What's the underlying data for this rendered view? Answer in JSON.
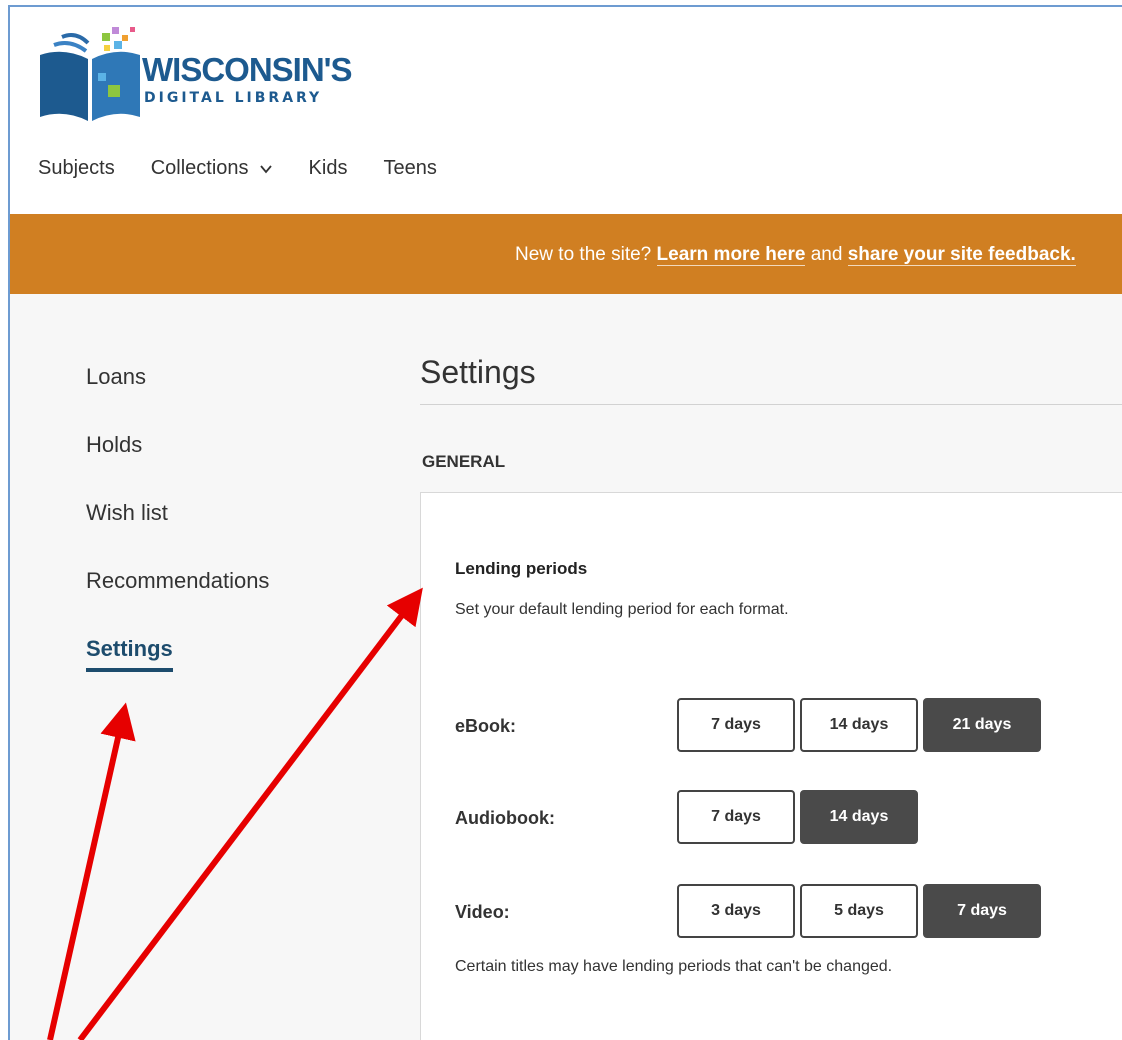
{
  "logo": {
    "title": "WISCONSIN'S",
    "subtitle": "DIGITAL LIBRARY"
  },
  "nav": {
    "items": [
      {
        "label": "Subjects"
      },
      {
        "label": "Collections",
        "has_dropdown": true
      },
      {
        "label": "Kids"
      },
      {
        "label": "Teens"
      }
    ]
  },
  "banner": {
    "prefix": "New to the site? ",
    "link1": "Learn more here",
    "middle": " and ",
    "link2": "share your site feedback.",
    "bg_color": "#d07f22"
  },
  "sidebar": {
    "items": [
      {
        "label": "Loans"
      },
      {
        "label": "Holds"
      },
      {
        "label": "Wish list"
      },
      {
        "label": "Recommendations"
      },
      {
        "label": "Settings",
        "active": true
      }
    ],
    "active_color": "#1d4c6d"
  },
  "main": {
    "title": "Settings",
    "section": "GENERAL",
    "card": {
      "title": "Lending periods",
      "description": "Set your default lending period for each format.",
      "rows": [
        {
          "label": "eBook:",
          "options": [
            "7 days",
            "14 days",
            "21 days"
          ],
          "selected": "21 days"
        },
        {
          "label": "Audiobook:",
          "options": [
            "7 days",
            "14 days"
          ],
          "selected": "14 days"
        },
        {
          "label": "Video:",
          "options": [
            "3 days",
            "5 days",
            "7 days"
          ],
          "selected": "7 days"
        }
      ],
      "note": "Certain titles may have lending periods that can't be changed."
    }
  },
  "annotation": {
    "arrow_color": "#e60000"
  }
}
